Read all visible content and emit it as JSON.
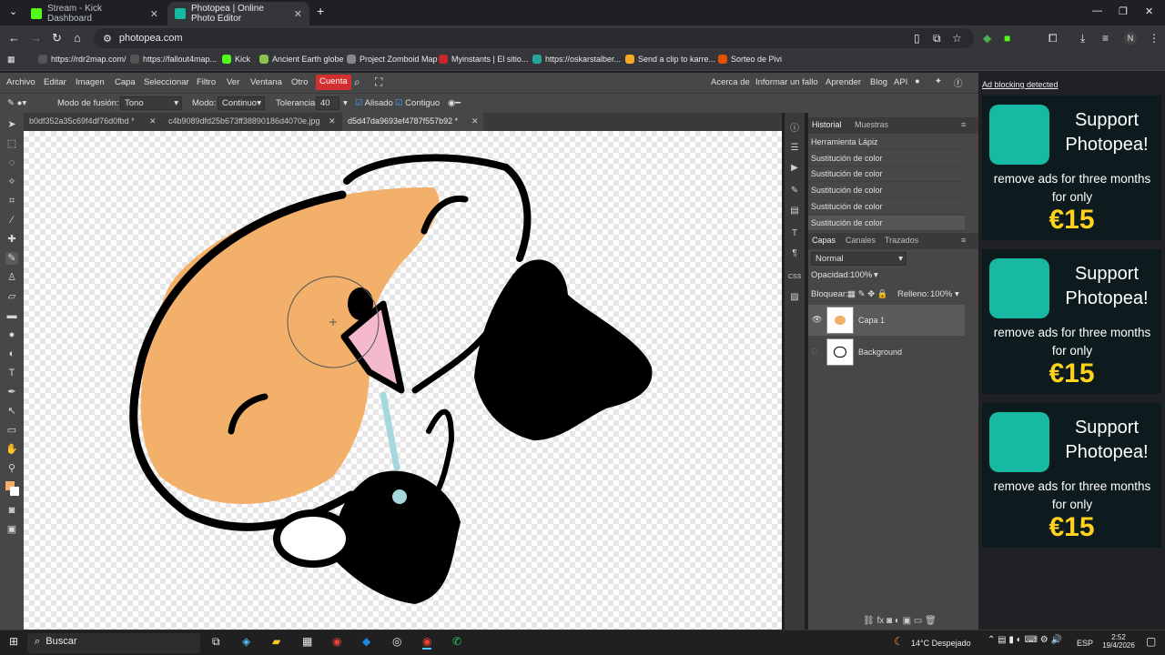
{
  "browser": {
    "tabs": [
      {
        "title": "Stream - Kick Dashboard",
        "active": false
      },
      {
        "title": "Photopea | Online Photo Editor",
        "active": true
      }
    ],
    "url": "photopea.com",
    "bookmarks": [
      "https://rdr2map.com/",
      "https://fallout4map...",
      "Kick",
      "Ancient Earth globe",
      "Project Zomboid Map",
      "Myinstants | El sitio...",
      "https://oskarstalber...",
      "Send a clip to karre...",
      "Sorteo de Pivi"
    ],
    "profile_initial": "N"
  },
  "menu": {
    "items": [
      "Archivo",
      "Editar",
      "Imagen",
      "Capa",
      "Seleccionar",
      "Filtro",
      "Ver",
      "Ventana",
      "Otro"
    ],
    "account": "Cuenta",
    "right": [
      "Acerca de",
      "Informar un fallo",
      "Aprender",
      "Blog",
      "API"
    ]
  },
  "options": {
    "blend_label": "Modo de fusión:",
    "blend_value": "Tono",
    "mode_label": "Modo:",
    "mode_value": "Continuo",
    "tolerance_label": "Tolerancia:",
    "tolerance_value": "40",
    "antialias": "Alisado",
    "contiguous": "Contiguo"
  },
  "doc_tabs": [
    "b0df352a35c69f4df76d0fbd",
    "c4b9089dfd25b673ff38890186d4070e.jpg",
    "d5d47da9693ef4787f557b92"
  ],
  "history": {
    "tabs": [
      "Historial",
      "Muestras"
    ],
    "items": [
      "Herramienta Lápiz",
      "Sustitución de color",
      "Sustitución de color",
      "Sustitución de color",
      "Sustitución de color",
      "Sustitución de color"
    ]
  },
  "layers": {
    "tabs": [
      "Capas",
      "Canales",
      "Trazados"
    ],
    "blend": "Normal",
    "opacity_label": "Opacidad:",
    "opacity": "100%",
    "lock_label": "Bloquear:",
    "fill_label": "Relleno:",
    "fill": "100%",
    "items": [
      "Capa 1",
      "Background"
    ]
  },
  "ads": {
    "notice": "Ad blocking detected",
    "title": "Support Photopea!",
    "text": "remove ads for three months for only",
    "price": "€15"
  },
  "taskbar": {
    "search": "Buscar",
    "weather": "14°C  Despejado",
    "lang": "ESP",
    "time": "2:52",
    "date": "19/4/2026"
  },
  "colors": {
    "accent": "#d32f2f",
    "ad_green": "#17b9a3",
    "ad_price": "#ffd21c",
    "drawing_orange": "#f2b06a",
    "drawing_pink": "#f4b8cf",
    "drawing_blue": "#a4d8dc"
  }
}
